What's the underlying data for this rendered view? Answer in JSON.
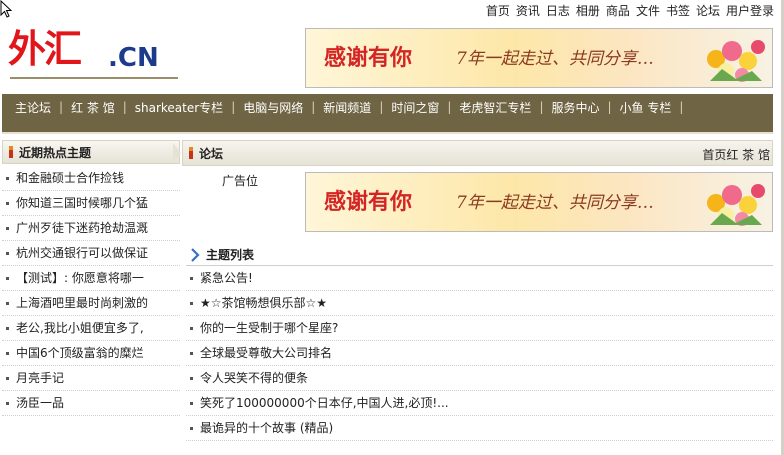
{
  "top_nav": [
    "首页",
    "资讯",
    "日志",
    "相册",
    "商品",
    "文件",
    "书签",
    "论坛",
    "用户登录"
  ],
  "logo": {
    "main": "外汇",
    "suffix": ".CN"
  },
  "banner": {
    "highlight": "感谢有你",
    "rest": "7年一起走过、共同分享…"
  },
  "main_nav": [
    "主论坛",
    "红 茶 馆",
    "sharkeater专栏",
    "电脑与网络",
    "新闻频道",
    "时间之窗",
    "老虎智汇专栏",
    "服务中心",
    "小鱼 专栏"
  ],
  "sidebar": {
    "title": "近期热点主题",
    "items": [
      "和金融硕士合作捡钱",
      "你知道三国时候哪几个猛",
      "广州歹徒下迷药抢劫温溉",
      "杭州交通银行可以做保证",
      "【测试】: 你愿意将哪一",
      "上海酒吧里最时尚刺激的",
      "老公,我比小姐便宜多了,",
      "中国6个顶级富翁的糜烂",
      "月亮手记",
      "汤臣一品"
    ]
  },
  "content": {
    "title": "论坛",
    "breadcrumb": "首页红 茶 馆",
    "ad_label": "广告位",
    "topics_title": "主题列表",
    "topics": [
      "紧急公告!",
      "★☆茶馆畅想俱乐部☆★",
      "你的一生受制于哪个星座?",
      "全球最受尊敬大公司排名",
      "令人哭笑不得的便条",
      "笑死了100000000个日本仔,中国人进,必顶!...",
      "最诡异的十个故事 (精品)"
    ]
  },
  "colors": {
    "nav_bg": "#6f6443",
    "logo_red": "#e0161a",
    "logo_blue": "#1d3b8c",
    "accent_bar": "#c73218"
  }
}
